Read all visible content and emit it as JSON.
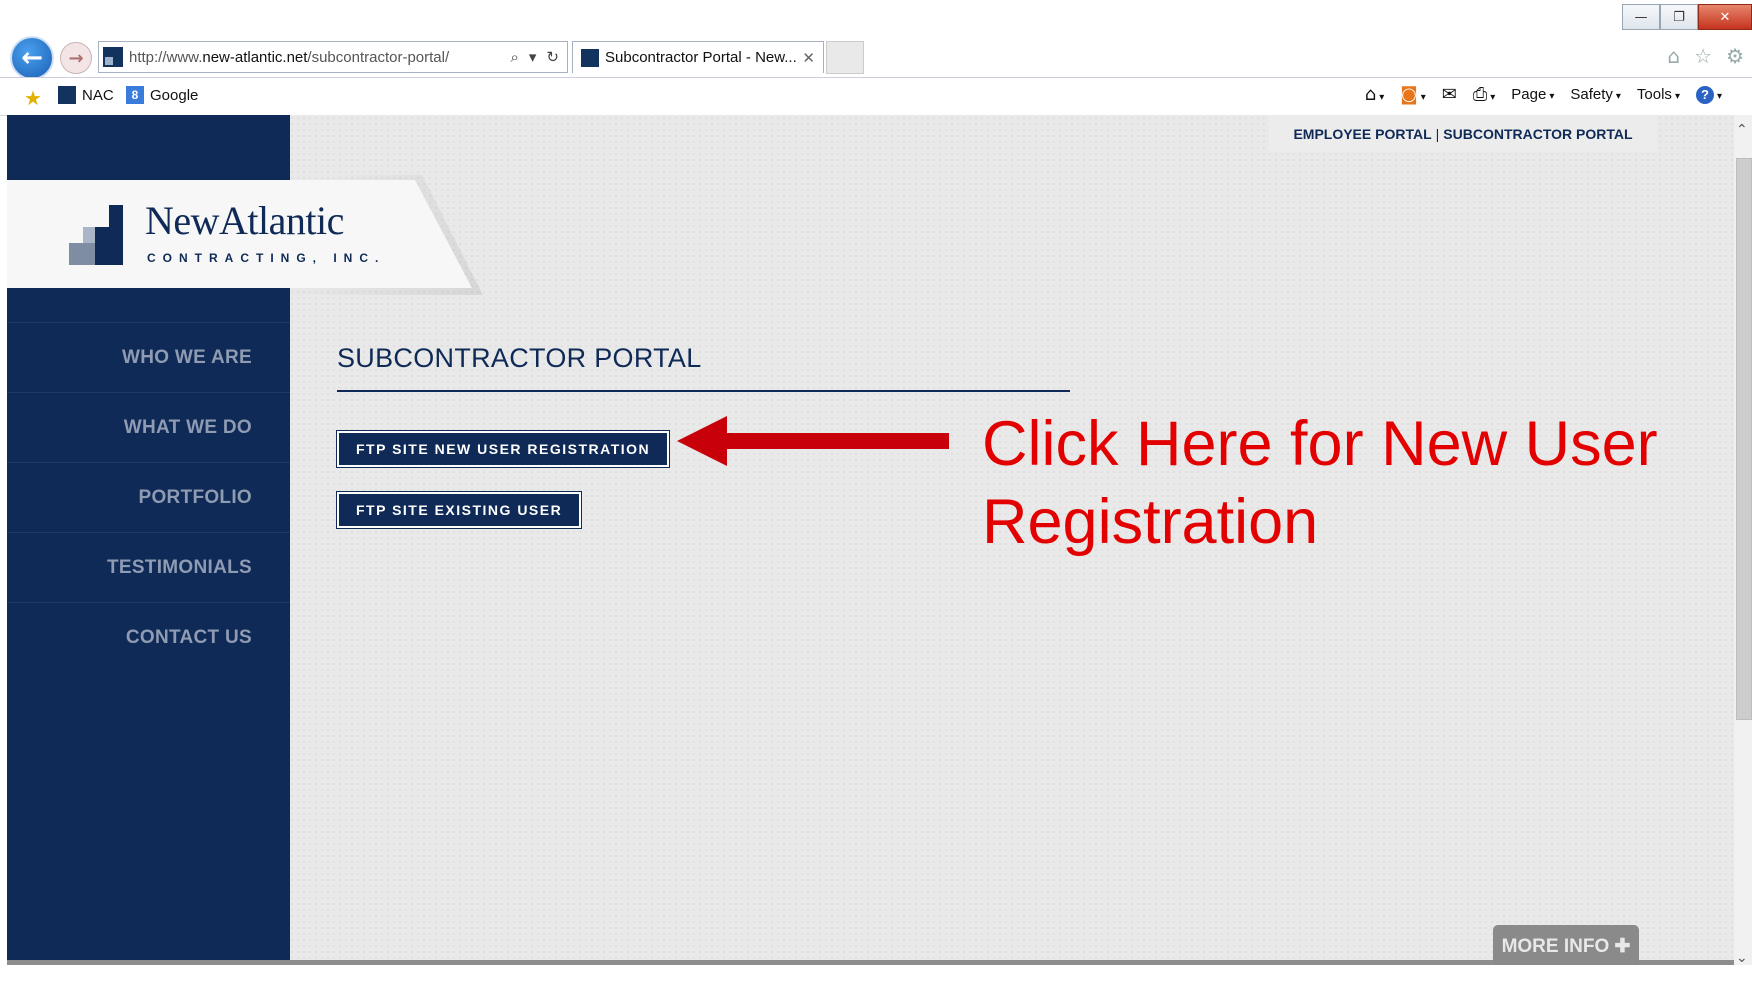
{
  "window": {
    "minimize_glyph": "—",
    "restore_glyph": "❐",
    "close_glyph": "✕"
  },
  "address_bar": {
    "url_prefix": "http://www.",
    "url_domain": "new-atlantic.net",
    "url_path": "/subcontractor-portal/",
    "search_glyph": "⌕",
    "dropdown_glyph": "▾",
    "refresh_glyph": "↻"
  },
  "tab": {
    "label": "Subcontractor Portal - New...",
    "close_glyph": "✕"
  },
  "browser_icons": {
    "home_glyph": "⌂",
    "favorites_glyph": "☆",
    "settings_glyph": "⚙"
  },
  "favorites_bar": {
    "add_favorite_glyph": "★",
    "items": [
      {
        "label": "NAC"
      },
      {
        "label": "Google",
        "icon_letter": "8"
      }
    ]
  },
  "command_bar": {
    "home_glyph": "⌂",
    "feeds_glyph": "◙",
    "mail_glyph": "✉",
    "print_glyph": "⎙",
    "caret": "▾",
    "page_label": "Page",
    "safety_label": "Safety",
    "tools_label": "Tools",
    "help_glyph": "?"
  },
  "site": {
    "logo_name": "NewAtlantic",
    "logo_subtitle": "CONTRACTING, INC.",
    "top_links": {
      "employee": "EMPLOYEE PORTAL",
      "separator": "|",
      "subcontractor": "SUBCONTRACTOR PORTAL"
    },
    "nav": [
      {
        "label": "WHO WE ARE"
      },
      {
        "label": "WHAT WE DO"
      },
      {
        "label": "PORTFOLIO"
      },
      {
        "label": "TESTIMONIALS"
      },
      {
        "label": "CONTACT US"
      }
    ],
    "page_title": "SUBCONTRACTOR PORTAL",
    "buttons": {
      "new_user": "FTP SITE NEW USER REGISTRATION",
      "existing_user": "FTP SITE EXISTING USER"
    },
    "more_info": "MORE INFO ✚",
    "brand_color": "#0f2a56"
  },
  "annotation": {
    "callout_text": "Click Here for New User Registration",
    "color": "#e20000"
  },
  "scrollbar": {
    "up_glyph": "⌃",
    "down_glyph": "⌄"
  }
}
